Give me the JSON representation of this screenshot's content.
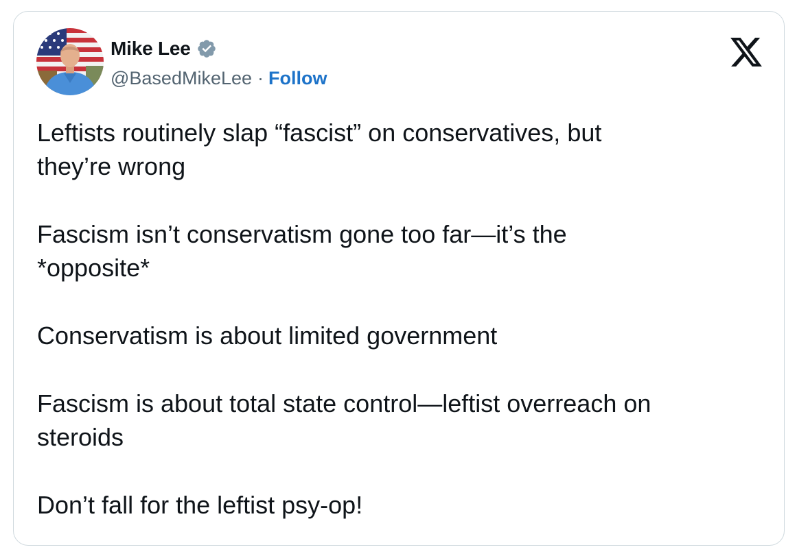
{
  "author": {
    "name": "Mike Lee",
    "handle": "@BasedMikeLee",
    "separator": "·",
    "follow_label": "Follow",
    "verified_icon": "verified-badge-icon",
    "badge_color": "#829aab"
  },
  "platform_icon": "x-logo-icon",
  "tweet": {
    "paragraphs": [
      {
        "line1": "Leftists routinely slap “fascist” on conservatives, but",
        "line2": "they’re wrong"
      },
      {
        "line1": "Fascism isn’t conservatism gone too far—it’s the",
        "line2": "*opposite*"
      },
      {
        "line1": "Conservatism is about limited government",
        "line2": ""
      },
      {
        "line1": "Fascism is about total state control—leftist overreach on",
        "line2": "steroids"
      },
      {
        "line1": "Don’t fall for the leftist psy-op!",
        "line2": ""
      }
    ]
  },
  "colors": {
    "text": "#0f1419",
    "secondary_text": "#536471",
    "link": "#1d73c9",
    "border": "#cfd9de"
  }
}
